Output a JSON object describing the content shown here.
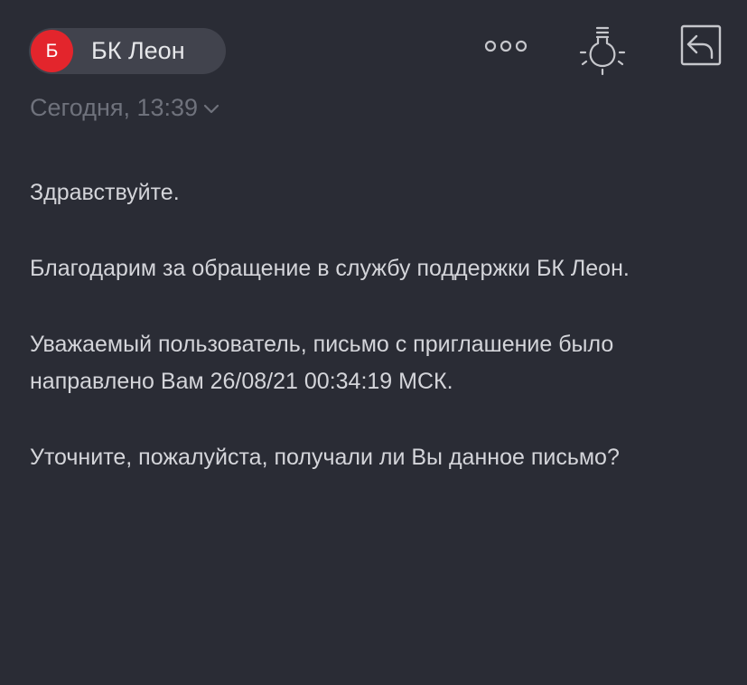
{
  "header": {
    "sender": {
      "avatar_letter": "Б",
      "name": "БК Леон"
    },
    "icons": {
      "more": "more-dots-icon",
      "tip": "lightbulb-icon",
      "reply": "reply-icon"
    }
  },
  "meta": {
    "date": "Сегодня, 13:39"
  },
  "message": {
    "paragraphs": [
      "Здравствуйте.",
      "Благодарим за обращение в службу поддержки БК Леон.",
      "Уважаемый пользователь, письмо с приглашение было направлено Вам 26/08/21 00:34:19 МСК.",
      "Уточните, пожалуйста, получали ли Вы данное письмо?"
    ]
  },
  "colors": {
    "background": "#2a2c35",
    "chip": "#41434d",
    "avatar": "#e3252c",
    "text": "#d4d5da",
    "muted": "#6f727c",
    "icon": "#c6c7cc"
  }
}
